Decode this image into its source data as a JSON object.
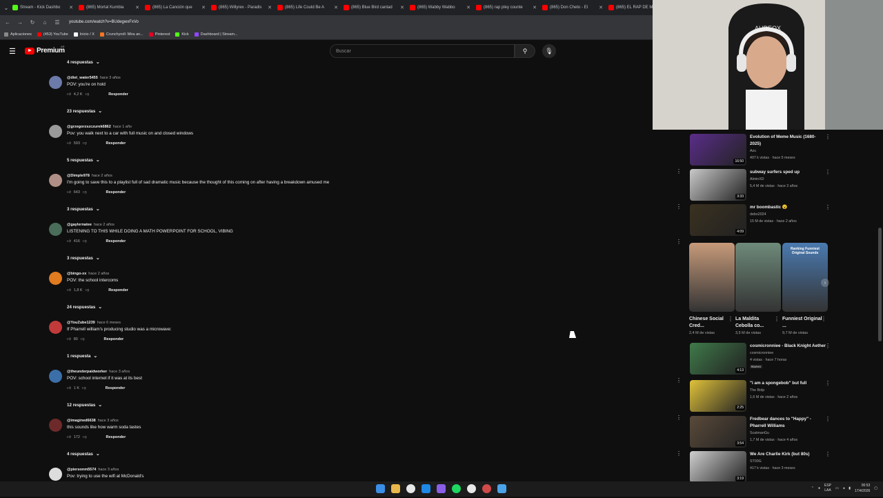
{
  "browser": {
    "tabs": [
      {
        "title": "Stream - Kick Dashbo",
        "color": "#53fc18"
      },
      {
        "title": "(865) Mortal Kumbia",
        "color": "#ff0000"
      },
      {
        "title": "(865) La Canción que",
        "color": "#ff0000"
      },
      {
        "title": "(865) Willyrex - Paradis",
        "color": "#ff0000"
      },
      {
        "title": "(865) Life Could Be A",
        "color": "#ff0000"
      },
      {
        "title": "(865) Blue Bird cantad",
        "color": "#ff0000"
      },
      {
        "title": "(865) Wabby Wabbo",
        "color": "#ff0000"
      },
      {
        "title": "(865) rap pley counte",
        "color": "#ff0000"
      },
      {
        "title": "(865) Don Cheto - El",
        "color": "#ff0000"
      },
      {
        "title": "(865) EL RAP DE M",
        "color": "#ff0000"
      }
    ],
    "url": "youtube.com/watch?v=BUdegwxFxVo",
    "bookmarks": [
      {
        "label": "Aplicaciones",
        "color": "#888888"
      },
      {
        "label": "(453) YouTube",
        "color": "#ff0000"
      },
      {
        "label": "Inicio / X",
        "color": "#ffffff"
      },
      {
        "label": "Crunchyroll: Mira an...",
        "color": "#f47521"
      },
      {
        "label": "Pinterest",
        "color": "#e60023"
      },
      {
        "label": "Kick",
        "color": "#53fc18"
      },
      {
        "label": "Dashboard | Stream...",
        "color": "#9146ff"
      }
    ]
  },
  "youtube": {
    "logo_text": "Premium",
    "logo_sup": "AR",
    "search_placeholder": "Buscar"
  },
  "comments": {
    "top_toggle": "4 respuestas",
    "reply_label": "Responder",
    "items": [
      {
        "author": "@diet_water5455",
        "time": "hace 3 años",
        "text": "POV: you're on hold",
        "likes": "4,2 K",
        "replies": "23 respuestas",
        "avatar": "#6b7aa8"
      },
      {
        "author": "@grzegorzszczurek6862",
        "time": "hace 1 año",
        "text": "Pov: you walk next to a car with full music on and closed windows",
        "likes": "593",
        "replies": "5 respuestas",
        "avatar": "#9a9a9a"
      },
      {
        "author": "@Dimple978",
        "time": "hace 2 años",
        "text": "I'm going to save this to a playlist full of sad dramatic music because the thought of this coming on after having a breakdown amused me",
        "likes": "643",
        "replies": "3 respuestas",
        "avatar": "#b08f86"
      },
      {
        "author": "@gaylernatee",
        "time": "hace 2 años",
        "text": "LISTENING TO THIS WHILE DOING A MATH POWERPOINT FOR SCHOOL, VIBING",
        "likes": "416",
        "replies": "3 respuestas",
        "avatar": "#4a6d5a"
      },
      {
        "author": "@bingo-xx",
        "time": "hace 2 años",
        "text": "POV: the school intercoms",
        "likes": "1,8 K",
        "replies": "24 respuestas",
        "avatar": "#e07b20"
      },
      {
        "author": "@YouZube1239",
        "time": "hace 6 meses",
        "text": "If Pharrell william's producing studio was a microwave:",
        "likes": "80",
        "replies": "1 respuesta",
        "avatar": "#c23a3a"
      },
      {
        "author": "@theunderpaidworker",
        "time": "hace 3 años",
        "text": "POV: school internet if it was at its best",
        "likes": "1 K",
        "replies": "12 respuestas",
        "avatar": "#3b6fa8"
      },
      {
        "author": "@imagined6638",
        "time": "hace 3 años",
        "text": "this sounds like how warm soda tastes",
        "likes": "172",
        "replies": "4 respuestas",
        "avatar": "#6e2a2a"
      },
      {
        "author": "@piersonm5574",
        "time": "hace 3 años",
        "text": "Pov: trying to use the wifi at McDonald's",
        "likes": "",
        "replies": "",
        "avatar": "#dddddd"
      }
    ]
  },
  "recommendations": [
    {
      "title": "Evolution of Meme Music (1680-2025)",
      "channel": "Azu",
      "meta": "407 k vistas · hace 5 meses",
      "duration": "16:50",
      "thumb": "#5a2d8a"
    },
    {
      "title": "subway surfers sped up",
      "channel": "AlminXD",
      "meta": "5,4 M de vistas · hace 3 años",
      "duration": "3:33",
      "thumb": "#c9c9c9"
    },
    {
      "title": "mr boombastic 😮",
      "channel": "debo2024",
      "meta": "15 M de vistas · hace 2 años",
      "duration": "4:09",
      "thumb": "#3a3120"
    },
    {
      "title": "cosmicronniee - Black Knight Aether",
      "channel": "cosmicronniee",
      "meta": "4 vistas · hace 7 horas",
      "badge": "Nuevo",
      "duration": "4:13",
      "thumb": "#3f7a4a"
    },
    {
      "title": "\"i am a spongebob\" but full",
      "channel": "The Bolp",
      "meta": "1,6 M de vistas · hace 2 años",
      "duration": "2:25",
      "thumb": "#e0c23a"
    },
    {
      "title": "Fredbear dances to \"Happy\" - Pharrell Williams",
      "channel": "ScatmanGu",
      "meta": "1,7 M de vistas · hace 4 años",
      "duration": "3:54",
      "thumb": "#5a4a3a"
    },
    {
      "title": "We Are Charlie Kirk (but 80s)",
      "channel": "ST00G",
      "meta": "417 k vistas · hace 3 meses",
      "duration": "3:19",
      "thumb": "#cfcfcf"
    }
  ],
  "shorts": [
    {
      "title": "Chinese Social Cred...",
      "views": "2,4 M de vistas",
      "thumb": "#c79a7a"
    },
    {
      "title": "La Maldita Cebolla co...",
      "views": "3,5 M de vistas",
      "thumb": "#6e8a7a"
    },
    {
      "title": "Funniest Original ...",
      "views": "9,7 M de vistas",
      "thumb": "#4a7ab0",
      "overlay": "Ranking Funniest Original Sounds"
    }
  ],
  "taskbar": {
    "lang": "ESP",
    "lang2": "LAA",
    "time": "00:53",
    "date": "17/4/2026"
  }
}
